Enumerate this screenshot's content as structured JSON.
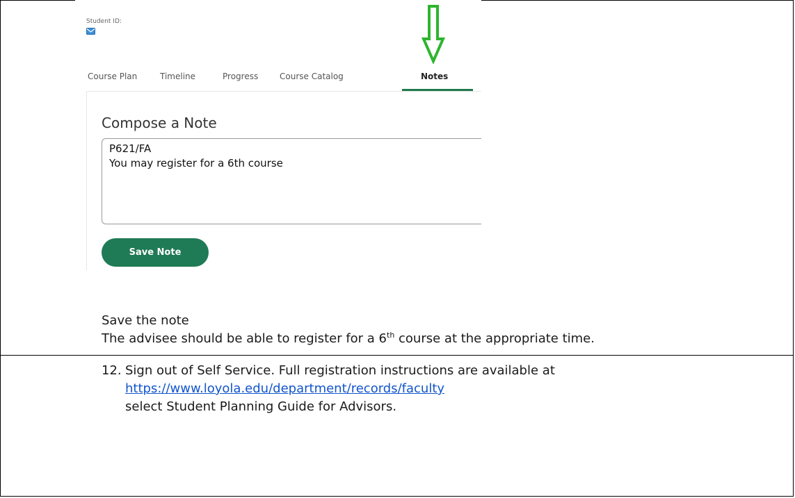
{
  "screenshot": {
    "student_id_label": "Student ID: ",
    "tabs": [
      {
        "label": "Course Plan"
      },
      {
        "label": "Timeline"
      },
      {
        "label": "Progress"
      },
      {
        "label": "Course Catalog"
      },
      {
        "label": "Notes"
      }
    ],
    "compose_title": "Compose a Note",
    "note_text": "P621/FA\nYou may register for a 6th course",
    "save_button": "Save Note",
    "accent_color": "#1f7a56",
    "arrow_color": "#2db52d"
  },
  "instructions": {
    "save_line": "Save the note",
    "advisee_line_a": "The advisee should be able to register for a 6",
    "advisee_line_sup": "th",
    "advisee_line_b": " course at the appropriate time.",
    "step_number": "12.",
    "step_line1": "Sign out of Self Service. Full registration instructions are available at",
    "step_link": "https://www.loyola.edu/department/records/faculty",
    "step_line3": "select Student Planning Guide for Advisors."
  }
}
